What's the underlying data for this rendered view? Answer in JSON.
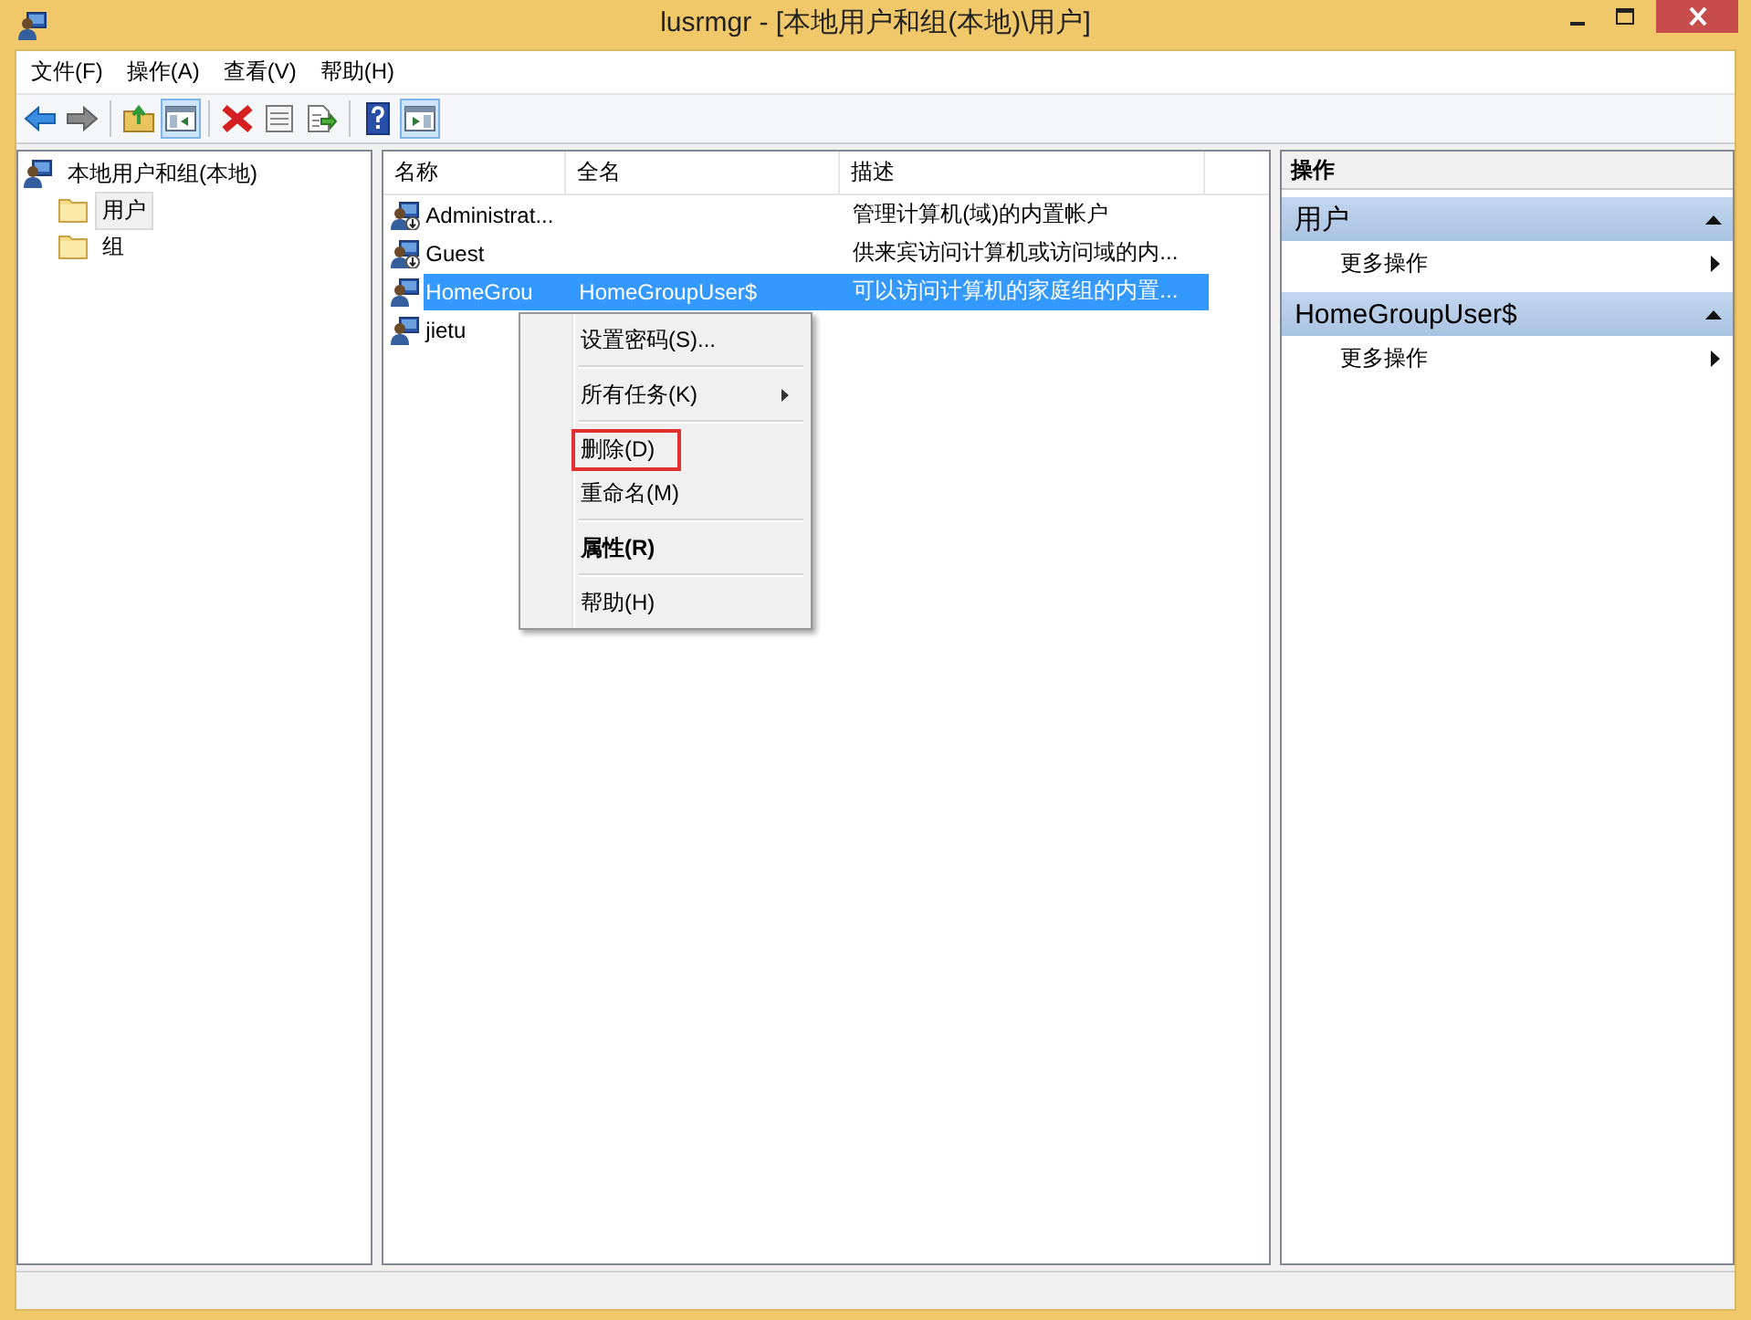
{
  "window": {
    "title": "lusrmgr - [本地用户和组(本地)\\用户]"
  },
  "menu_bar": [
    "文件(F)",
    "操作(A)",
    "查看(V)",
    "帮助(H)"
  ],
  "toolbar": [
    {
      "kind": "back",
      "pressed": false
    },
    {
      "kind": "forward",
      "pressed": false
    },
    {
      "kind": "separator"
    },
    {
      "kind": "up",
      "pressed": false
    },
    {
      "kind": "tree",
      "pressed": true
    },
    {
      "kind": "separator"
    },
    {
      "kind": "delete",
      "pressed": false
    },
    {
      "kind": "properties",
      "pressed": false
    },
    {
      "kind": "export",
      "pressed": false
    },
    {
      "kind": "separator"
    },
    {
      "kind": "help",
      "pressed": false
    },
    {
      "kind": "actionpane",
      "pressed": true
    }
  ],
  "tree": {
    "label": "本地用户和组(本地)",
    "children": [
      {
        "label": "用户",
        "selected": true
      },
      {
        "label": "组",
        "selected": false
      }
    ]
  },
  "table": {
    "columns": [
      "名称",
      "全名",
      "描述"
    ],
    "rows": [
      {
        "name": "Administrat...",
        "full_name": "",
        "description": "管理计算机(域)的内置帐户",
        "selected": false,
        "kind": "admin"
      },
      {
        "name": "Guest",
        "full_name": "",
        "description": "供来宾访问计算机或访问域的内...",
        "selected": false,
        "kind": "admin"
      },
      {
        "name": "HomeGrou",
        "full_name": "HomeGroupUser$",
        "description": "可以访问计算机的家庭组的内置...",
        "selected": true,
        "kind": "user"
      },
      {
        "name": "jietu",
        "full_name": "",
        "description": "",
        "selected": false,
        "kind": "user"
      }
    ]
  },
  "context_menu": [
    {
      "kind": "item",
      "label": "设置密码(S)...",
      "default": false,
      "highlighted": false
    },
    {
      "kind": "separator"
    },
    {
      "kind": "submenu",
      "label": "所有任务(K)",
      "default": false,
      "highlighted": false
    },
    {
      "kind": "separator"
    },
    {
      "kind": "item",
      "label": "删除(D)",
      "default": false,
      "highlighted": true
    },
    {
      "kind": "item",
      "label": "重命名(M)",
      "default": false,
      "highlighted": false
    },
    {
      "kind": "separator"
    },
    {
      "kind": "item",
      "label": "属性(R)",
      "default": true,
      "highlighted": false
    },
    {
      "kind": "separator"
    },
    {
      "kind": "item",
      "label": "帮助(H)",
      "default": false,
      "highlighted": false
    }
  ],
  "actions_pane": {
    "title": "操作",
    "sections": [
      {
        "title": "用户",
        "expanded": true,
        "items": [
          "更多操作"
        ]
      },
      {
        "title": "HomeGroupUser$",
        "expanded": true,
        "items": [
          "更多操作"
        ]
      }
    ]
  }
}
